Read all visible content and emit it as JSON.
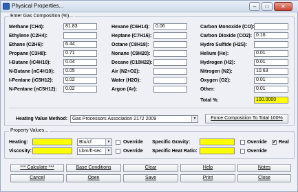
{
  "window": {
    "title": "Physical Properties..."
  },
  "gas_group": {
    "title": "Enter Gas Composition (%)..."
  },
  "components_col1": [
    {
      "label": "Methane (CH4):",
      "value": "81.83"
    },
    {
      "label": "Ethylene (C2H4):",
      "value": ""
    },
    {
      "label": "Ethane (C2H6):",
      "value": "6.44"
    },
    {
      "label": "Propane (C3H8):",
      "value": "0.71"
    },
    {
      "label": "I-Butane (iC4H10):",
      "value": "0.04"
    },
    {
      "label": "N-Butane (nC4H10):",
      "value": "0.05"
    },
    {
      "label": "I-Pentane (iC5H12):",
      "value": "0.02"
    },
    {
      "label": "N-Pentane (nC5H12):",
      "value": "0.02"
    }
  ],
  "components_col2": [
    {
      "label": "Hexane (C6H14):",
      "value": "0.06"
    },
    {
      "label": "Heptane (C7H16):",
      "value": ""
    },
    {
      "label": "Octane (C8H18):",
      "value": ""
    },
    {
      "label": "Nonane (C9H20):",
      "value": ""
    },
    {
      "label": "Decane (C10H22):",
      "value": ""
    },
    {
      "label": "Air (N2+O2):",
      "value": ""
    },
    {
      "label": "Water (H2O):",
      "value": ""
    },
    {
      "label": "Argon (Ar):",
      "value": ""
    }
  ],
  "components_col3": [
    {
      "label": "Carbon Monoxide (CO):",
      "value": ""
    },
    {
      "label": "Carbon Dioxide (CO2):",
      "value": "0.16"
    },
    {
      "label": "Hydro Sulfide (H2S):",
      "value": ""
    },
    {
      "label": "Helium (He):",
      "value": "0.01"
    },
    {
      "label": "Hydrogen (H2):",
      "value": "0.01"
    },
    {
      "label": "Nitrogen (N2):",
      "value": "10.63"
    },
    {
      "label": "Oxygen (O2):",
      "value": "0.01"
    },
    {
      "label": "Other:",
      "value": "0.01"
    }
  ],
  "total": {
    "label": "Total %:",
    "value": "100.0000"
  },
  "heating_method": {
    "label": "Heating Value Method:",
    "value": "Gas Processors Association 2172 2009"
  },
  "force_button": "Force Composition To Total 100%",
  "property_group": {
    "title": "Property Values..."
  },
  "properties": {
    "heating_label": "Heating:",
    "heating_value": "",
    "heating_unit": "Btu/cf",
    "viscosity_label": "Viscosity:",
    "viscosity_value": "",
    "viscosity_unit": "Lbm/ft-sec",
    "override_label": "Override",
    "specific_gravity_label": "Specific Gravity:",
    "specific_gravity_value": "",
    "specific_heat_ratio_label": "Specific Heat Ratio:",
    "specific_heat_ratio_value": "",
    "real_label": "Real",
    "real_checked": "✔"
  },
  "buttons": {
    "calculate": "*** Calculate ***",
    "base_conditions": "Base Conditions",
    "clear": "Clear",
    "help": "Help",
    "notes": "Notes",
    "cancel": "Cancel",
    "open": "Open",
    "save": "Save",
    "print": "Print",
    "close": "Close"
  },
  "icons": {
    "app": "app-icon",
    "minimize": "minimize-icon",
    "maximize": "maximize-icon",
    "close": "close-icon",
    "dropdown": "chevron-down-icon"
  },
  "colors": {
    "highlight_field": "#ffff00",
    "titlebar": "#cfdbea",
    "close_button": "#c94431"
  }
}
